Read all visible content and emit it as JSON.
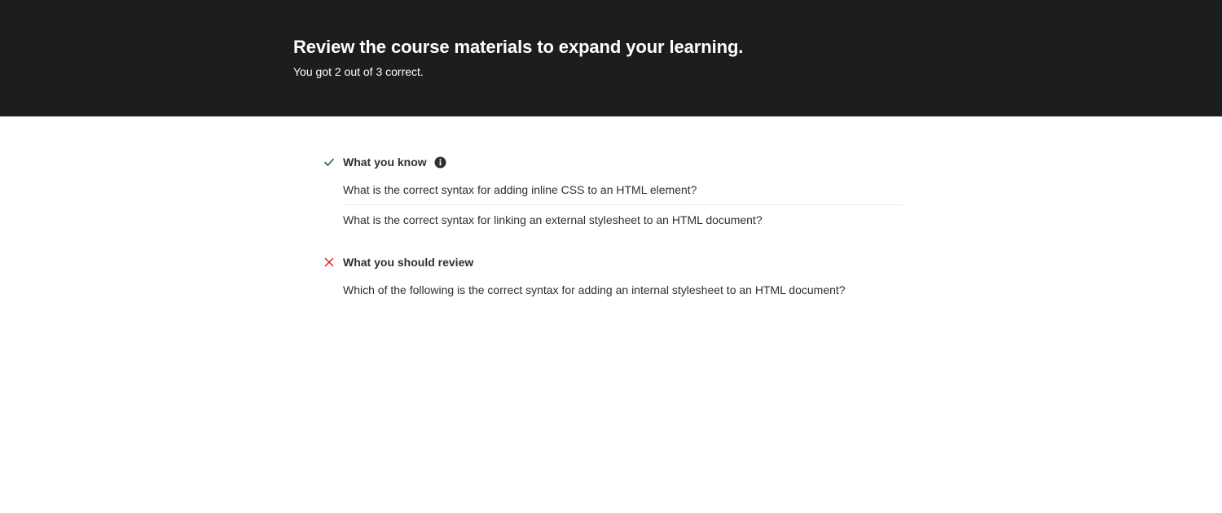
{
  "banner": {
    "title": "Review the course materials to expand your learning.",
    "score_text": "You got 2 out of 3 correct."
  },
  "sections": {
    "known": {
      "title": "What you know",
      "status_icon": "check-icon",
      "status_color": "#1e6055",
      "questions": [
        "What is the correct syntax for adding inline CSS to an HTML element?",
        "What is the correct syntax for linking an external stylesheet to an HTML document?"
      ]
    },
    "review": {
      "title": "What you should review",
      "status_icon": "x-icon",
      "status_color": "#d0271d",
      "questions": [
        "Which of the following is the correct syntax for adding an internal stylesheet to an HTML document?"
      ]
    }
  },
  "colors": {
    "banner_bg": "#1c1d1f",
    "text": "#2d2f31"
  }
}
